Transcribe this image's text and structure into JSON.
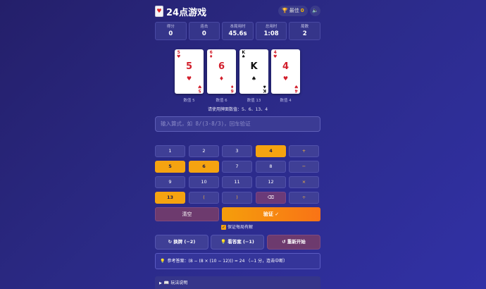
{
  "header": {
    "logo_text": "♥",
    "title": "24点游戏",
    "best_label": "最佳",
    "best_value": "0",
    "sound_icon": "🔈"
  },
  "stats": [
    {
      "label": "得分",
      "value": "0"
    },
    {
      "label": "连击",
      "value": "0"
    },
    {
      "label": "本局用时",
      "value": "45.6s"
    },
    {
      "label": "总用时",
      "value": "1:08"
    },
    {
      "label": "局数",
      "value": "2"
    }
  ],
  "cards": [
    {
      "rank": "5",
      "suit": "♥",
      "color": "red",
      "value_label": "数值 5"
    },
    {
      "rank": "6",
      "suit": "♦",
      "color": "red",
      "value_label": "数值 6"
    },
    {
      "rank": "K",
      "suit": "♠",
      "color": "black",
      "value_label": "数值 13"
    },
    {
      "rank": "4",
      "suit": "♥",
      "color": "red",
      "value_label": "数值 4"
    }
  ],
  "hint_line": "请使用牌面数值：5、6、13、4",
  "expression_input": {
    "placeholder": "输入算式，如 8/(3-8/3)，回车验证",
    "value": ""
  },
  "keypad": [
    [
      {
        "label": "1",
        "state": "normal"
      },
      {
        "label": "2",
        "state": "normal"
      },
      {
        "label": "3",
        "state": "normal"
      },
      {
        "label": "4",
        "state": "sel"
      },
      {
        "label": "+",
        "state": "op"
      }
    ],
    [
      {
        "label": "5",
        "state": "sel"
      },
      {
        "label": "6",
        "state": "sel"
      },
      {
        "label": "7",
        "state": "normal"
      },
      {
        "label": "8",
        "state": "normal"
      },
      {
        "label": "−",
        "state": "op"
      }
    ],
    [
      {
        "label": "9",
        "state": "normal"
      },
      {
        "label": "10",
        "state": "normal"
      },
      {
        "label": "11",
        "state": "normal"
      },
      {
        "label": "12",
        "state": "normal"
      },
      {
        "label": "×",
        "state": "op"
      }
    ],
    [
      {
        "label": "13",
        "state": "sel"
      },
      {
        "label": "(",
        "state": "op"
      },
      {
        "label": ")",
        "state": "op"
      },
      {
        "label": "⌫",
        "state": "back"
      },
      {
        "label": "÷",
        "state": "op"
      }
    ]
  ],
  "buttons": {
    "clear": "清空",
    "verify": "验证 ✓"
  },
  "guarantee": {
    "checked": true,
    "label": "保证每局有解"
  },
  "actions": {
    "swap": "换牌 (−2)",
    "answer": "看答案 (−1)",
    "restart": "重新开始"
  },
  "reference": "参考答案：(8 − (8 × (10 − 12))) = 24 （−1 分，连击中断）",
  "rules_label": "玩法说明",
  "colors": {
    "accent": "#f5a310",
    "background": "#2b2a86",
    "red_suit": "#d21e2b"
  }
}
